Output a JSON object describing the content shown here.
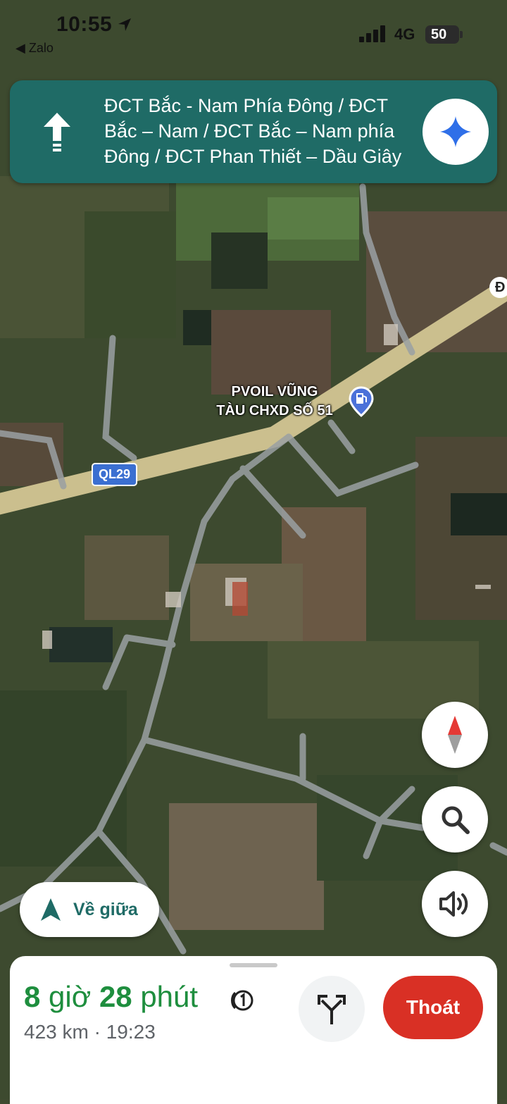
{
  "status_bar": {
    "time": "10:55",
    "back_app": "◀ Zalo",
    "network": "4G",
    "battery": "50"
  },
  "instruction": {
    "text": "ĐCT Bắc - Nam Phía Đông / ĐCT Bắc – Nam / ĐCT Bắc – Nam phía Đông / ĐCT Phan Thiết – Dầu Giây",
    "direction_icon": "arrow-up-icon"
  },
  "map": {
    "road_shield": "QL29",
    "poi": {
      "line1": "PVOIL VŨNG",
      "line2": "TÀU CHXD SỐ 51",
      "icon": "gas-station-icon"
    },
    "edge_label": "Đ"
  },
  "buttons": {
    "recenter_label": "Về giữa",
    "exit_label": "Thoát"
  },
  "trip": {
    "hours": "8",
    "hours_unit": "giờ",
    "minutes": "28",
    "minutes_unit": "phút",
    "distance": "423 km",
    "separator": "·",
    "arrival": "19:23"
  },
  "colors": {
    "banner": "#1f6b66",
    "eta_green": "#1e8e3e",
    "exit_red": "#d93025",
    "road_shield": "#3b6fd1"
  }
}
